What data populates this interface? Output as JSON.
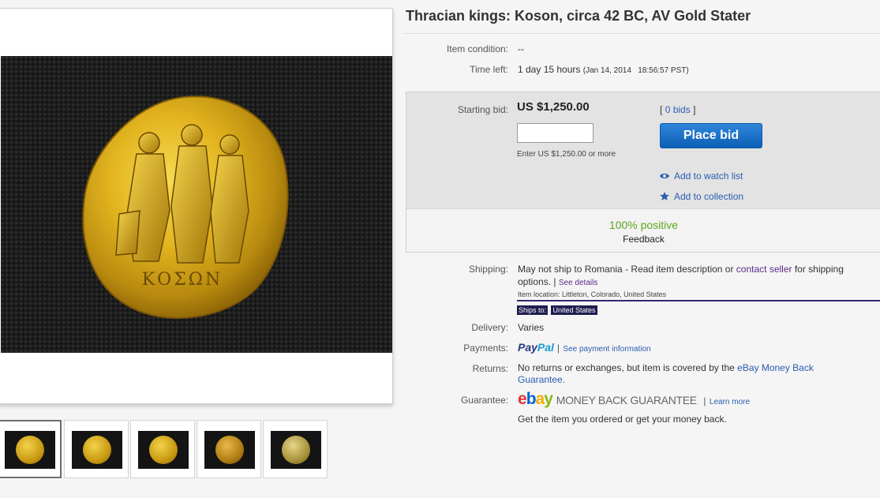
{
  "listing": {
    "title": "Thracian kings: Koson, circa 42 BC, AV Gold Stater",
    "condition_label": "Item condition:",
    "condition_value": "--",
    "time_left_label": "Time left:",
    "time_left_value": "1 day 15 hours",
    "time_left_end": "(Jan 14, 2014   18:56:57 PST)"
  },
  "bid": {
    "starting_label": "Starting bid:",
    "starting_value": "US $1,250.00",
    "input_value": "",
    "hint": "Enter US $1,250.00 or more",
    "bids_open": "[",
    "bids_link": "0 bids",
    "bids_close": "]",
    "place_bid_label": "Place bid",
    "watch_label": "Add to watch list",
    "collection_label": "Add to collection",
    "feedback_percent": "100% positive",
    "feedback_label": "Feedback"
  },
  "shipping": {
    "label": "Shipping:",
    "text_before": "May not ship to Romania - Read item description or ",
    "contact_link": "contact seller",
    "text_after": " for shipping",
    "line2": "options.",
    "separator": "|",
    "details_link": "See details",
    "location_label": "Item location:",
    "location_value": "Littleton, Colorado, United States",
    "ships_to_label": "Ships to:",
    "ships_to_value": "United States"
  },
  "delivery": {
    "label": "Delivery:",
    "value": "Varies"
  },
  "payments": {
    "label": "Payments:",
    "brand_pay": "Pay",
    "brand_pal": "Pal",
    "separator": "|",
    "info_link": "See payment information"
  },
  "returns": {
    "label": "Returns:",
    "text": "No returns or exchanges, but item is covered by the ",
    "link_part1": "eBay Money Back",
    "link_part2": "Guarantee."
  },
  "guarantee": {
    "label": "Guarantee:",
    "logo_e": "e",
    "logo_b": "b",
    "logo_a": "a",
    "logo_y": "y",
    "mbg_text": "MONEY BACK GUARANTEE",
    "separator": "|",
    "learn_more": "Learn more",
    "note": "Get the item you ordered or get your money back."
  },
  "coin": {
    "legend": "ΚΟΣΩΝ"
  },
  "colors": {
    "link": "#2a5db0",
    "feedback_green": "#5ba71b",
    "button_blue": "#0c5fb5",
    "ebay_e": "#e53238",
    "ebay_b": "#0064d2",
    "ebay_a": "#f5af02",
    "ebay_y": "#86b817"
  },
  "icons": {
    "watch": "eye-icon",
    "collection": "star-icon"
  }
}
